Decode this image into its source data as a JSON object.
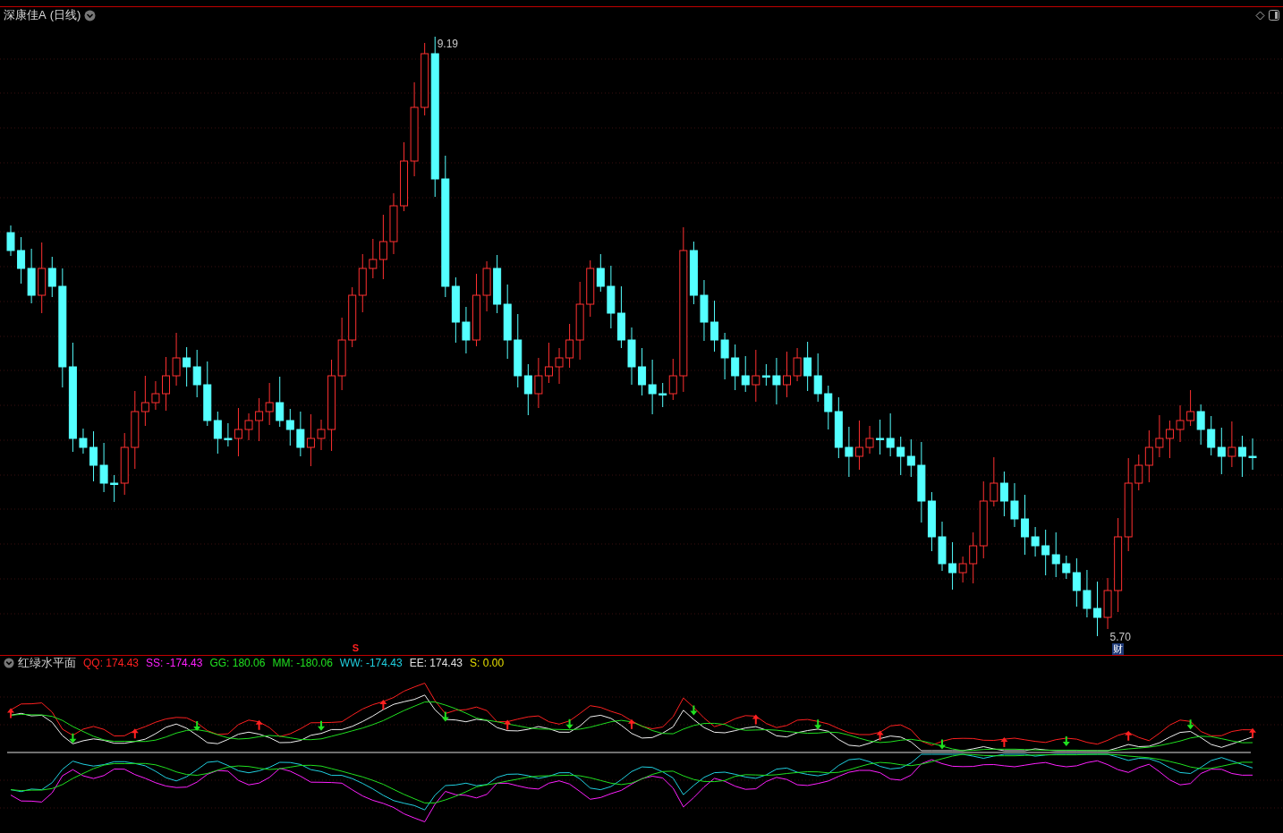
{
  "chart_header": {
    "stock_name": "深康佳A",
    "period": "(日线)"
  },
  "price_chart": {
    "high_label": "9.19",
    "low_label": "5.70",
    "signal_marker": "S",
    "event_badge": "财"
  },
  "indicator": {
    "name": "红绿水平面",
    "values": [
      {
        "label": "QQ:",
        "value": "174.43",
        "color": "#ff2020"
      },
      {
        "label": "SS:",
        "value": "-174.43",
        "color": "#ff20ff"
      },
      {
        "label": "GG:",
        "value": "180.06",
        "color": "#20e020"
      },
      {
        "label": "MM:",
        "value": "-180.06",
        "color": "#20e020"
      },
      {
        "label": "WW:",
        "value": "-174.43",
        "color": "#20d0e0"
      },
      {
        "label": "EE:",
        "value": "174.43",
        "color": "#e0e0e0"
      },
      {
        "label": "S:",
        "value": "0.00",
        "color": "#e8e000"
      }
    ]
  }
}
